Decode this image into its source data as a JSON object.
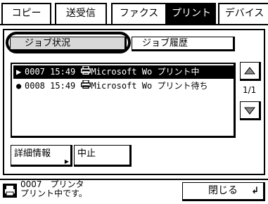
{
  "tabs": [
    {
      "label": "コピー",
      "active": false
    },
    {
      "label": "送受信",
      "active": false
    },
    {
      "label": "ファクス",
      "active": false
    },
    {
      "label": "プリント",
      "active": true
    },
    {
      "label": "デバイス",
      "active": false
    }
  ],
  "subtabs": {
    "job_status": "ジョブ状況",
    "job_history": "ジョブ履歴"
  },
  "jobs": [
    {
      "mark": "▶",
      "number": "0007",
      "time": "15:49",
      "name": "Microsoft Wo",
      "status": "プリント中",
      "selected": true
    },
    {
      "mark": "●",
      "number": "0008",
      "time": "15:49",
      "name": "Microsoft Wo",
      "status": "プリント待ち",
      "selected": false
    }
  ],
  "page_indicator": "1/1",
  "actions": {
    "details": "詳細情報",
    "cancel": "中止"
  },
  "status": {
    "line1": "0007　プリンタ",
    "line2": "プリント中です。"
  },
  "close_label": "閉じる",
  "icons": {
    "printer": "printer-icon",
    "scroll_up": "triangle-up-icon",
    "scroll_down": "triangle-down-icon",
    "enter": "enter-key-icon"
  },
  "colors": {
    "active_tab_bg": "#000000",
    "selected_subtab_bg": "#d8d8d8",
    "selected_row_bg": "#000000"
  }
}
